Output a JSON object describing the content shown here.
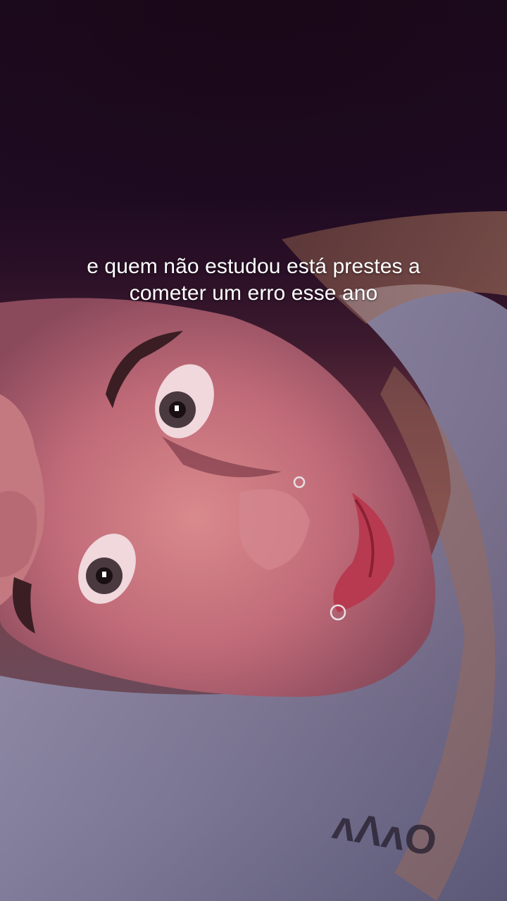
{
  "caption": {
    "line1": "e quem não estudou está prestes a",
    "line2": "cometer um erro esse ano"
  },
  "colors": {
    "background_top": "#1c0a1f",
    "skin": "#c07078",
    "hoodie": "#8a8aa6",
    "caption_text": "#ffffff"
  }
}
